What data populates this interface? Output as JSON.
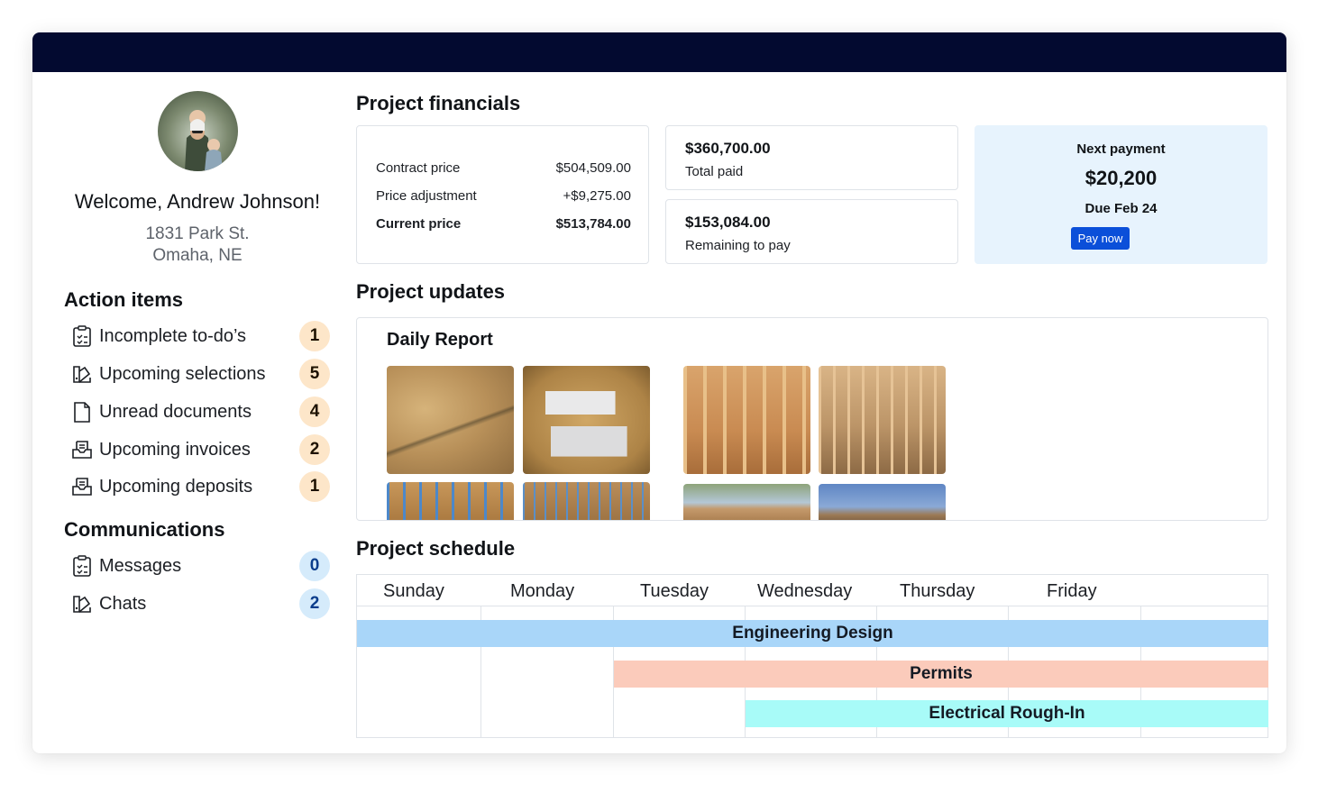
{
  "user": {
    "welcome": "Welcome, Andrew Johnson!",
    "address_line1": "1831 Park St.",
    "address_line2": "Omaha, NE"
  },
  "action_items": {
    "title": "Action items",
    "items": [
      {
        "label": "Incomplete to-do’s",
        "count": "1",
        "icon": "clipboard-check-icon"
      },
      {
        "label": "Upcoming selections",
        "count": "5",
        "icon": "swatch-icon"
      },
      {
        "label": "Unread documents",
        "count": "4",
        "icon": "document-icon"
      },
      {
        "label": "Upcoming invoices",
        "count": "2",
        "icon": "invoice-tray-icon"
      },
      {
        "label": "Upcoming deposits",
        "count": "1",
        "icon": "invoice-tray-icon"
      }
    ]
  },
  "communications": {
    "title": "Communications",
    "items": [
      {
        "label": "Messages",
        "count": "0",
        "icon": "clipboard-check-icon"
      },
      {
        "label": "Chats",
        "count": "2",
        "icon": "swatch-icon"
      }
    ]
  },
  "financials": {
    "title": "Project financials",
    "rows": [
      {
        "label": "Contract price",
        "value": "$504,509.00"
      },
      {
        "label": "Price adjustment",
        "value": "+$9,275.00"
      },
      {
        "label": "Current price",
        "value": "$513,784.00"
      }
    ],
    "total_paid": {
      "amount": "$360,700.00",
      "label": "Total paid"
    },
    "remaining": {
      "amount": "$153,084.00",
      "label": "Remaining to pay"
    },
    "next_payment": {
      "label": "Next payment",
      "amount": "$20,200",
      "due": "Due Feb 24",
      "button": "Pay now"
    }
  },
  "updates": {
    "title": "Project updates",
    "report_title": "Daily Report"
  },
  "schedule": {
    "title": "Project schedule",
    "days": [
      "Sunday",
      "Monday",
      "Tuesday",
      "Wednesday",
      "Thursday",
      "Friday"
    ],
    "tasks": [
      {
        "name": "Engineering Design",
        "color": "#a9d6f9"
      },
      {
        "name": "Permits",
        "color": "#fbcbbb"
      },
      {
        "name": "Electrical Rough-In",
        "color": "#a8fbf8"
      }
    ]
  },
  "colors": {
    "topbar": "#030a30",
    "accent": "#0b4fd9",
    "badge_orange": "#fde6c9",
    "badge_blue": "#d5ebfb",
    "next_payment_bg": "#e7f3fd"
  }
}
